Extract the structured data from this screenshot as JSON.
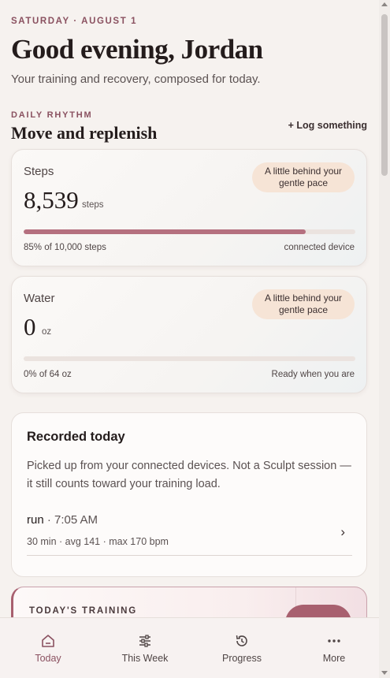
{
  "header": {
    "eyebrow": "SATURDAY · AUGUST 1",
    "greeting": "Good evening, Jordan",
    "subtitle": "Your training and recovery, composed for today."
  },
  "daily_rhythm": {
    "eyebrow": "DAILY RHYTHM",
    "title": "Move and replenish",
    "log_link": "+ Log something"
  },
  "metrics": [
    {
      "label": "Steps",
      "value": "8,539",
      "unit": "steps",
      "pill": "A little behind your gentle pace",
      "progress_percent": 85,
      "foot_left": "85% of 10,000 steps",
      "foot_right": "connected device"
    },
    {
      "label": "Water",
      "value": "0",
      "unit": "oz",
      "pill": "A little behind your gentle pace",
      "progress_percent": 0,
      "foot_left": "0% of 64 oz",
      "foot_right": "Ready when you are"
    }
  ],
  "recorded": {
    "title": "Recorded today",
    "description": "Picked up from your connected devices. Not a Sculpt session — it still counts toward your training load.",
    "activity_name": "run",
    "activity_time": " · 7:05 AM",
    "activity_stats": "30 min · avg 141 · max 170 bpm"
  },
  "training": {
    "eyebrow": "TODAY'S TRAINING"
  },
  "nav": {
    "items": [
      {
        "label": "Today",
        "icon": "home-icon"
      },
      {
        "label": "This Week",
        "icon": "sliders-icon"
      },
      {
        "label": "Progress",
        "icon": "history-icon"
      },
      {
        "label": "More",
        "icon": "more-icon"
      }
    ],
    "active": "Today"
  },
  "colors": {
    "accent": "#8a5160",
    "progress_fill": "#b5707f",
    "pill_bg": "#f6e4d6",
    "background": "#f6f2ef"
  }
}
